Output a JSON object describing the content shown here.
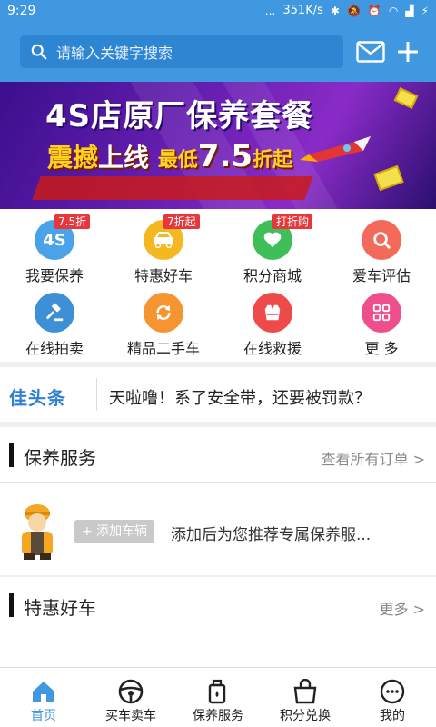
{
  "status": {
    "time": "9:29",
    "speed": "351K/s",
    "dots": "..."
  },
  "search": {
    "placeholder": "请输入关键字搜索"
  },
  "banner": {
    "brand": "4S店原厂保养套餐",
    "headline_part1": "震撼",
    "headline_part2": "上线",
    "headline_part3": "最低",
    "discount": "7.5",
    "discount_suffix": "折起"
  },
  "grid": [
    {
      "label": "我要保养",
      "icon": "4S",
      "badge": "7.5折",
      "color": "#4aa3e8"
    },
    {
      "label": "特惠好车",
      "icon": "car",
      "badge": "7折起",
      "color": "#f6b820"
    },
    {
      "label": "积分商城",
      "icon": "heart",
      "badge": "打折购",
      "color": "#3fbf5a"
    },
    {
      "label": "爱车评估",
      "icon": "magnifier",
      "badge": "",
      "color": "#f36a5b"
    },
    {
      "label": "在线拍卖",
      "icon": "hammer",
      "badge": "",
      "color": "#3d8fd6"
    },
    {
      "label": "精品二手车",
      "icon": "recycle",
      "badge": "",
      "color": "#f59431"
    },
    {
      "label": "在线救援",
      "icon": "vest",
      "badge": "",
      "color": "#ef4a4a"
    },
    {
      "label": "更 多",
      "icon": "grid",
      "badge": "",
      "color": "#ee4f8c"
    }
  ],
  "news": {
    "logo": "佳头条",
    "text": "天啦噜！系了安全带，还要被罚款？"
  },
  "maintenance": {
    "title": "保养服务",
    "more": "查看所有订单 >",
    "add_button": "+ 添加车辆",
    "desc": "添加后为您推荐专属保养服..."
  },
  "deals": {
    "title": "特惠好车",
    "more": "更多 >"
  },
  "nav": [
    {
      "label": "首页",
      "icon": "home-icon"
    },
    {
      "label": "买车卖车",
      "icon": "steering-wheel-icon"
    },
    {
      "label": "保养服务",
      "icon": "oil-can-icon"
    },
    {
      "label": "积分兑换",
      "icon": "shopping-bag-icon"
    },
    {
      "label": "我的",
      "icon": "smiley-icon"
    }
  ]
}
